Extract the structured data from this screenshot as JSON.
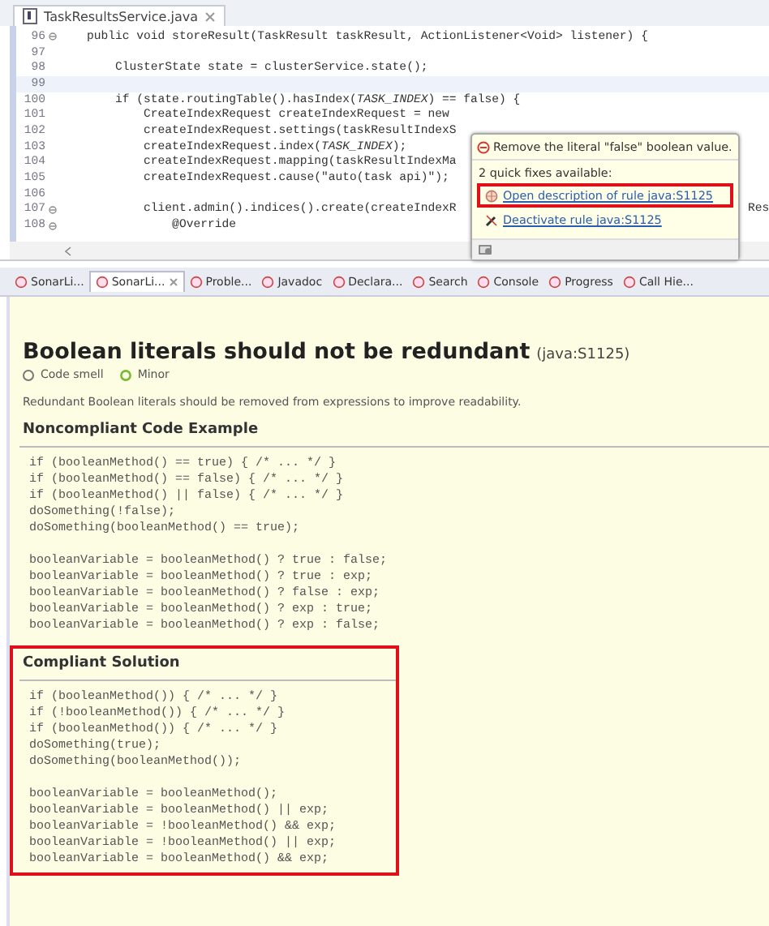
{
  "editor": {
    "tab": {
      "label": "TaskResultsService.java",
      "selected": true
    },
    "lines": [
      {
        "number": "96",
        "fold": true,
        "text": "    public void storeResult(TaskResult taskResult, ActionListener<Void> listener) {"
      },
      {
        "number": "97",
        "fold": false
      },
      {
        "number": "98",
        "fold": false,
        "text": "        ClusterState state = clusterService.state();"
      },
      {
        "number": "99",
        "fold": false,
        "current": true
      },
      {
        "number": "100",
        "fold": false,
        "text": "        if (state.routingTable().hasIndex(*TASK_INDEX*) == false) {"
      },
      {
        "number": "101",
        "fold": false,
        "text": "            CreateIndexRequest createIndexRequest = new"
      },
      {
        "number": "102",
        "fold": false,
        "text": "            createIndexRequest.settings(taskResultIndexS"
      },
      {
        "number": "103",
        "fold": false,
        "text": "            createIndexRequest.index(*TASK_INDEX*);"
      },
      {
        "number": "104",
        "fold": false,
        "text": "            createIndexRequest.mapping(taskResultIndexMa"
      },
      {
        "number": "105",
        "fold": false,
        "text": "            createIndexRequest.cause(\"auto(task api)\");"
      },
      {
        "number": "106",
        "fold": false
      },
      {
        "number": "107",
        "fold": true,
        "text": "            client.admin().indices().create(createIndexR",
        "tail": "Res"
      },
      {
        "number": "108",
        "fold": true,
        "text": "                @Override"
      }
    ],
    "popup": {
      "message": "Remove the literal \"false\" boolean value.",
      "subtitle": "2 quick fixes available:",
      "fixes": [
        {
          "label": "Open description of rule java:S1125",
          "kind": "open",
          "highlighted": true
        },
        {
          "label": "Deactivate rule java:S1125",
          "kind": "deactivate",
          "highlighted": false
        }
      ]
    }
  },
  "views": {
    "tabs": [
      {
        "label": "SonarLi...",
        "selected": false
      },
      {
        "label": "SonarLi...",
        "selected": true
      },
      {
        "label": "Proble...",
        "selected": false
      },
      {
        "label": "Javadoc",
        "selected": false
      },
      {
        "label": "Declara...",
        "selected": false
      },
      {
        "label": "Search",
        "selected": false
      },
      {
        "label": "Console",
        "selected": false
      },
      {
        "label": "Progress",
        "selected": false
      },
      {
        "label": "Call Hie...",
        "selected": false
      }
    ]
  },
  "rule": {
    "title": "Boolean literals should not be redundant",
    "key": "(java:S1125)",
    "type": "Code smell",
    "severity": "Minor",
    "description": "Redundant Boolean literals should be removed from expressions to improve readability.",
    "sections": [
      {
        "heading": "Noncompliant Code Example",
        "highlighted": false,
        "blocks": [
          [
            "if (booleanMethod() == true) { /* ... */ }",
            "if (booleanMethod() == false) { /* ... */ }",
            "if (booleanMethod() || false) { /* ... */ }",
            "doSomething(!false);",
            "doSomething(booleanMethod() == true);"
          ],
          [
            "booleanVariable = booleanMethod() ? true : false;",
            "booleanVariable = booleanMethod() ? true : exp;",
            "booleanVariable = booleanMethod() ? false : exp;",
            "booleanVariable = booleanMethod() ? exp : true;",
            "booleanVariable = booleanMethod() ? exp : false;"
          ]
        ]
      },
      {
        "heading": "Compliant Solution",
        "highlighted": true,
        "blocks": [
          [
            "if (booleanMethod()) { /* ... */ }",
            "if (!booleanMethod()) { /* ... */ }",
            "if (booleanMethod()) { /* ... */ }",
            "doSomething(true);",
            "doSomething(booleanMethod());"
          ],
          [
            "booleanVariable = booleanMethod();",
            "booleanVariable = booleanMethod() || exp;",
            "booleanVariable = !booleanMethod() && exp;",
            "booleanVariable = !booleanMethod() || exp;",
            "booleanVariable = booleanMethod() && exp;"
          ]
        ]
      }
    ]
  }
}
